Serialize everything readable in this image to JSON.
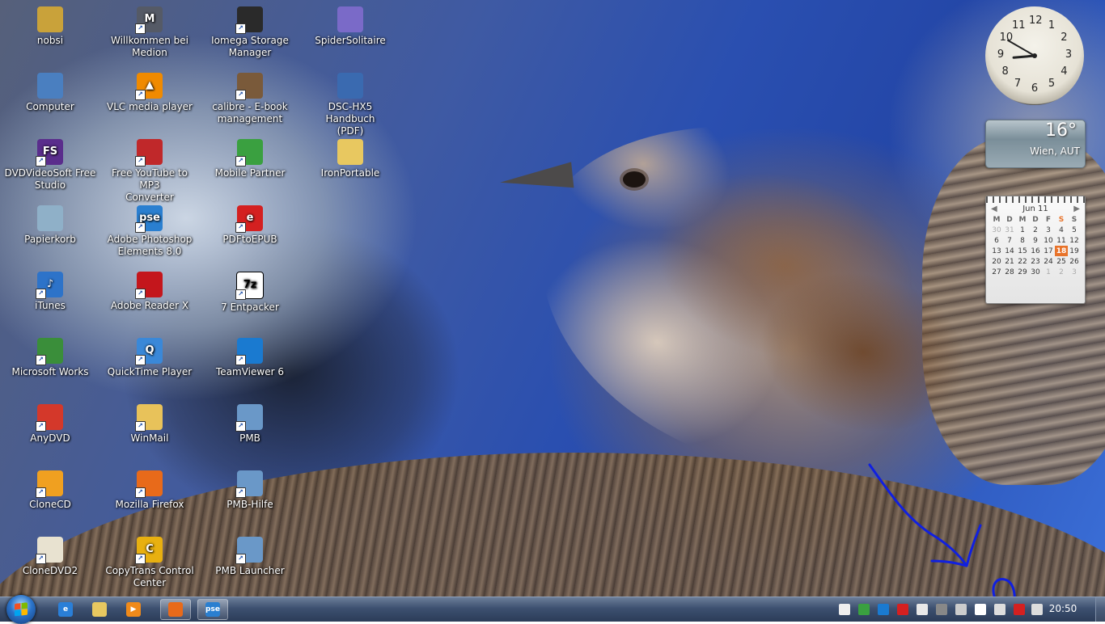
{
  "desktop": {
    "icons": [
      {
        "label_lines": [
          "nobsi",
          ""
        ],
        "icon": "user-folder-icon",
        "color": "#c9a23a",
        "glyph": ""
      },
      {
        "label_lines": [
          "Computer",
          ""
        ],
        "icon": "computer-icon",
        "color": "#4a7fc0",
        "glyph": ""
      },
      {
        "label_lines": [
          "DVDVideoSoft Free",
          "Studio"
        ],
        "icon": "dvdvideosoft-icon",
        "color": "#5a2d8c",
        "glyph": "FS"
      },
      {
        "label_lines": [
          "Papierkorb",
          ""
        ],
        "icon": "recycle-bin-icon",
        "color": "#8fb0c8",
        "glyph": ""
      },
      {
        "label_lines": [
          "iTunes",
          ""
        ],
        "icon": "itunes-icon",
        "color": "#2d73c9",
        "glyph": "♪"
      },
      {
        "label_lines": [
          "Microsoft Works",
          ""
        ],
        "icon": "microsoft-works-icon",
        "color": "#3a8e3a",
        "glyph": ""
      },
      {
        "label_lines": [
          "AnyDVD",
          ""
        ],
        "icon": "anydvd-icon",
        "color": "#d4382a",
        "glyph": ""
      },
      {
        "label_lines": [
          "CloneCD",
          ""
        ],
        "icon": "clonecd-icon",
        "color": "#f0a020",
        "glyph": ""
      },
      {
        "label_lines": [
          "CloneDVD2",
          ""
        ],
        "icon": "clonedvd-icon",
        "color": "#e8e2d0",
        "glyph": ""
      },
      {
        "label_lines": [
          "Willkommen bei",
          "Medion"
        ],
        "icon": "medion-icon",
        "color": "#555a66",
        "glyph": "M"
      },
      {
        "label_lines": [
          "VLC media player",
          ""
        ],
        "icon": "vlc-icon",
        "color": "#f08a00",
        "glyph": "▲"
      },
      {
        "label_lines": [
          "Free YouTube to MP3",
          "Converter"
        ],
        "icon": "youtube-mp3-icon",
        "color": "#c0282a",
        "glyph": ""
      },
      {
        "label_lines": [
          "Adobe Photoshop",
          "Elements 8.0"
        ],
        "icon": "photoshop-elements-icon",
        "color": "#2a7fd0",
        "glyph": "pse"
      },
      {
        "label_lines": [
          "Adobe Reader X",
          ""
        ],
        "icon": "adobe-reader-icon",
        "color": "#c4161c",
        "glyph": ""
      },
      {
        "label_lines": [
          "QuickTime Player",
          ""
        ],
        "icon": "quicktime-icon",
        "color": "#3a88d8",
        "glyph": "Q"
      },
      {
        "label_lines": [
          "WinMail",
          ""
        ],
        "icon": "winmail-icon",
        "color": "#e8c25a",
        "glyph": ""
      },
      {
        "label_lines": [
          "Mozilla Firefox",
          ""
        ],
        "icon": "firefox-icon",
        "color": "#e86a1a",
        "glyph": ""
      },
      {
        "label_lines": [
          "CopyTrans Control",
          "Center"
        ],
        "icon": "copytrans-icon",
        "color": "#e8b010",
        "glyph": "C"
      },
      {
        "label_lines": [
          "Iomega Storage",
          "Manager"
        ],
        "icon": "iomega-icon",
        "color": "#2a2a2a",
        "glyph": ""
      },
      {
        "label_lines": [
          "calibre - E-book",
          "management"
        ],
        "icon": "calibre-icon",
        "color": "#7a5a3a",
        "glyph": ""
      },
      {
        "label_lines": [
          "Mobile Partner",
          ""
        ],
        "icon": "mobile-partner-icon",
        "color": "#3aa040",
        "glyph": ""
      },
      {
        "label_lines": [
          "PDFtoEPUB",
          ""
        ],
        "icon": "pdftoepub-icon",
        "color": "#d42020",
        "glyph": "e"
      },
      {
        "label_lines": [
          "7 Entpacker",
          ""
        ],
        "icon": "7zip-icon",
        "color": "#ffffff",
        "glyph": "7z"
      },
      {
        "label_lines": [
          "TeamViewer 6",
          ""
        ],
        "icon": "teamviewer-icon",
        "color": "#1a7ad0",
        "glyph": ""
      },
      {
        "label_lines": [
          "PMB",
          ""
        ],
        "icon": "pmb-icon",
        "color": "#6a98c8",
        "glyph": ""
      },
      {
        "label_lines": [
          "PMB-Hilfe",
          ""
        ],
        "icon": "pmb-help-icon",
        "color": "#6a98c8",
        "glyph": ""
      },
      {
        "label_lines": [
          "PMB Launcher",
          ""
        ],
        "icon": "pmb-launcher-icon",
        "color": "#6a98c8",
        "glyph": ""
      },
      {
        "label_lines": [
          "SpiderSolitaire",
          ""
        ],
        "icon": "spider-solitaire-icon",
        "color": "#7a6ac8",
        "glyph": ""
      },
      {
        "label_lines": [
          "DSC-HX5 Handbuch",
          "(PDF)"
        ],
        "icon": "pdf-manual-icon",
        "color": "#3a6ab0",
        "glyph": ""
      },
      {
        "label_lines": [
          "IronPortable",
          ""
        ],
        "icon": "folder-icon",
        "color": "#e8c860",
        "glyph": ""
      }
    ]
  },
  "gadgets": {
    "clock": {
      "numbers": [
        "12",
        "1",
        "2",
        "3",
        "4",
        "5",
        "6",
        "7",
        "8",
        "9",
        "10",
        "11"
      ],
      "hour": 8,
      "minute": 50
    },
    "weather": {
      "temperature": "16°",
      "location": "Wien, AUT"
    },
    "calendar": {
      "month_label": "Jun 11",
      "prev": "◀",
      "next": "▶",
      "weekdays": [
        "M",
        "D",
        "M",
        "D",
        "F",
        "S",
        "S"
      ],
      "weeks": [
        [
          "30",
          "31",
          "1",
          "2",
          "3",
          "4",
          "5"
        ],
        [
          "6",
          "7",
          "8",
          "9",
          "10",
          "11",
          "12"
        ],
        [
          "13",
          "14",
          "15",
          "16",
          "17",
          "18",
          "19"
        ],
        [
          "20",
          "21",
          "22",
          "23",
          "24",
          "25",
          "26"
        ],
        [
          "27",
          "28",
          "29",
          "30",
          "1",
          "2",
          "3"
        ]
      ],
      "today": "18"
    }
  },
  "taskbar": {
    "pinned": [
      {
        "icon": "internet-explorer-icon",
        "color": "#2a7fd8",
        "glyph": "e"
      },
      {
        "icon": "explorer-folder-icon",
        "color": "#e8c860",
        "glyph": ""
      },
      {
        "icon": "media-player-icon",
        "color": "#f08a1a",
        "glyph": "▶"
      },
      {
        "icon": "firefox-taskbar-icon",
        "color": "#e86a1a",
        "glyph": ""
      },
      {
        "icon": "photoshop-elements-taskbar-icon",
        "color": "#2a7fd0",
        "glyph": "pse"
      }
    ],
    "tray_icons": [
      {
        "icon": "camera-icon",
        "color": "#eeeeee"
      },
      {
        "icon": "network-monitor-icon",
        "color": "#3aa040"
      },
      {
        "icon": "teamviewer-tray-icon",
        "color": "#1a7ad0"
      },
      {
        "icon": "adobe-tray-icon",
        "color": "#d42020"
      },
      {
        "icon": "antivirus-icon",
        "color": "#e8e8e8"
      },
      {
        "icon": "device-icon",
        "color": "#888888"
      },
      {
        "icon": "monitor-icon",
        "color": "#cccccc"
      },
      {
        "icon": "action-center-flag-icon",
        "color": "#ffffff"
      },
      {
        "icon": "safely-remove-icon",
        "color": "#dddddd"
      },
      {
        "icon": "network-disconnected-icon",
        "color": "#d42020"
      },
      {
        "icon": "volume-icon",
        "color": "#dddddd"
      }
    ],
    "time": "20:50"
  }
}
